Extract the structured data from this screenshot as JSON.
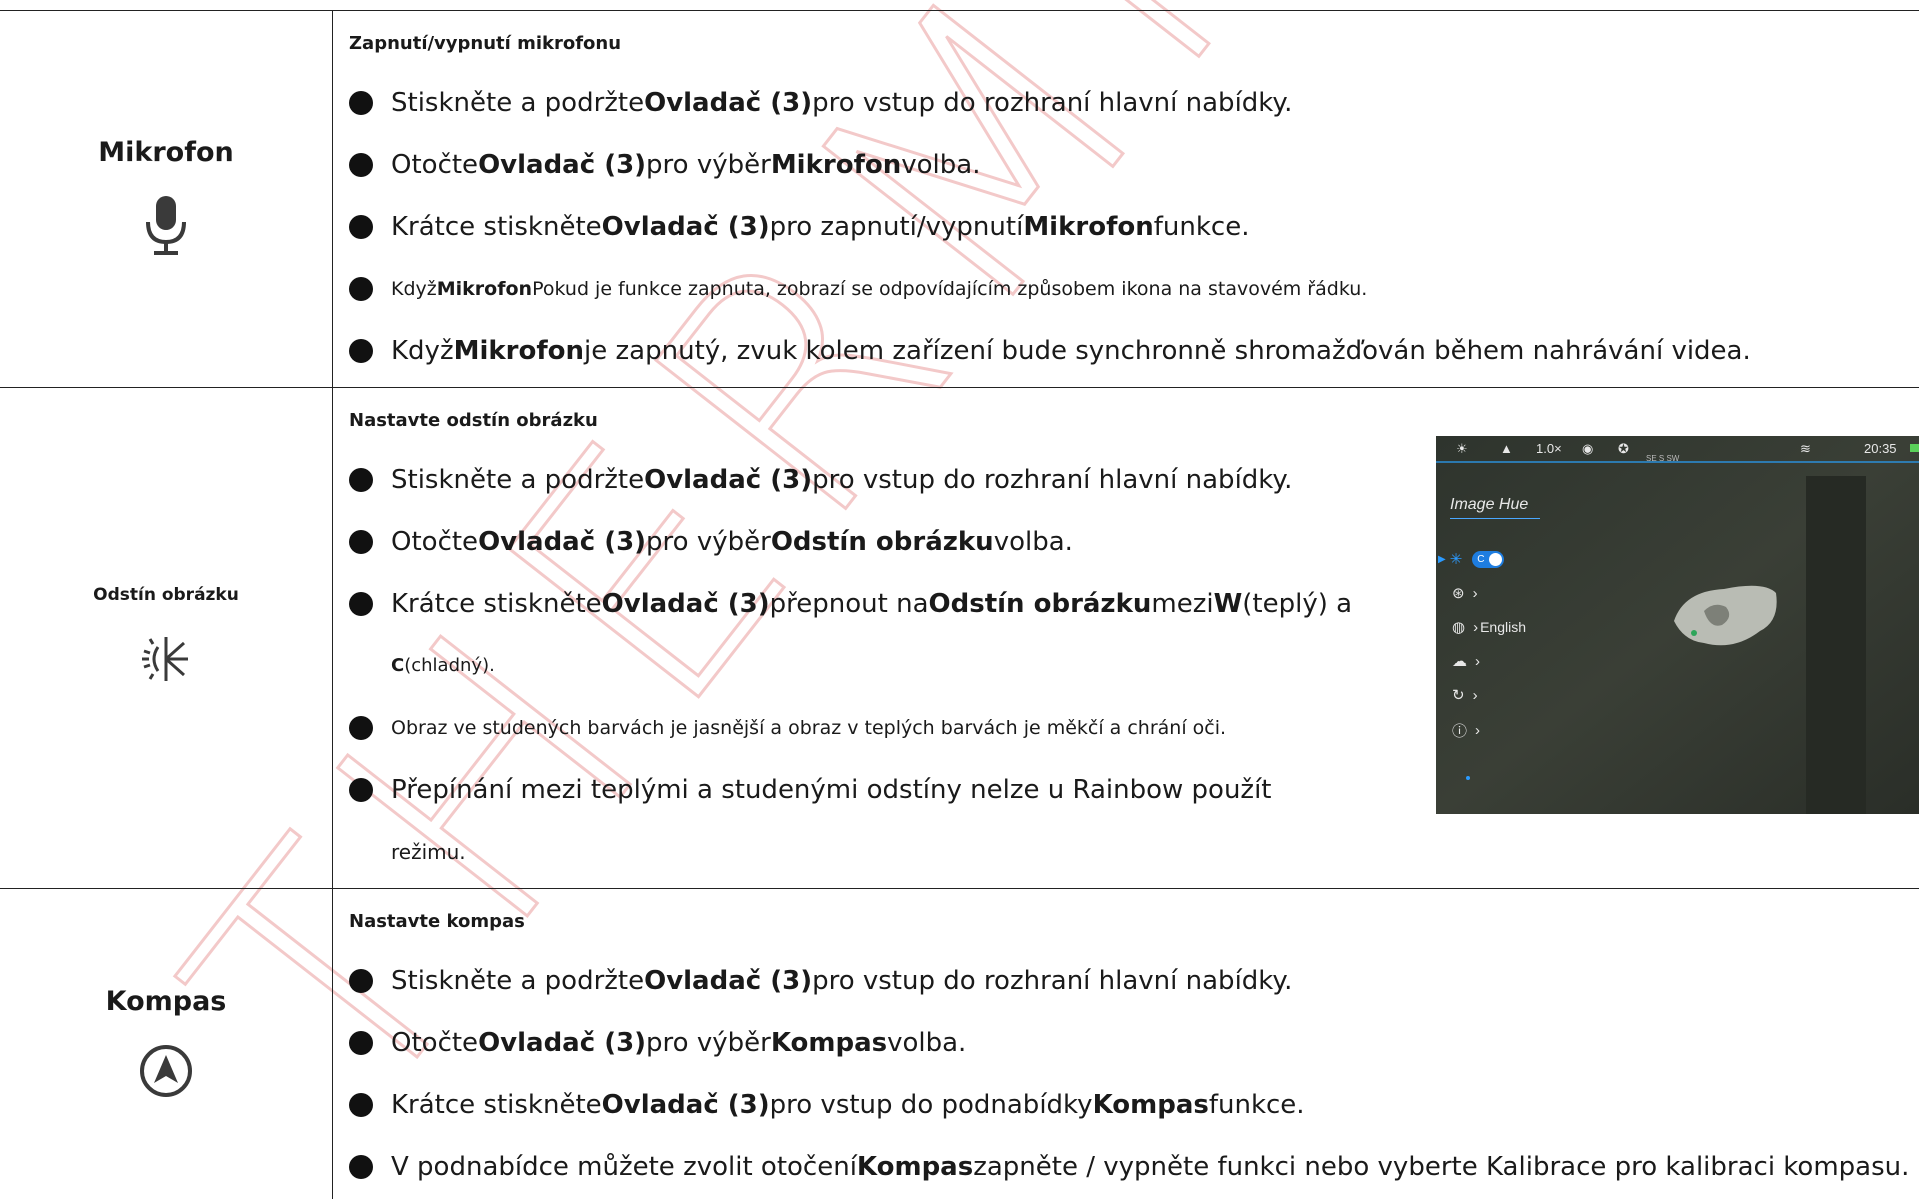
{
  "watermark": "THERMFOX",
  "colors": {
    "accent_blue": "#1e7de0",
    "watermark_red": "#f3c9c9",
    "screen_bg": "#2b2f29"
  },
  "sections": [
    {
      "title": "Mikrofon",
      "icon": "microphone-icon",
      "heading": "Zapnutí/vypnutí mikrofonu",
      "items": [
        {
          "a": "Stiskněte a podržte",
          "b": "Ovladač (3)",
          "c": "pro vstup do rozhraní hlavní nabídky."
        },
        {
          "a": "Otočte",
          "b": "Ovladač (3)",
          "c": "pro výběr",
          "d": "Mikrofon",
          "e": "volba."
        },
        {
          "a": "Krátce stiskněte",
          "b": "Ovladač (3)",
          "c": "pro zapnutí/vypnutí",
          "d": "Mikrofon",
          "e": "funkce."
        },
        {
          "a": "Když",
          "b": "Mikrofon",
          "c": "Pokud je funkce zapnuta, zobrazí se odpovídajícím způsobem ikona na stavovém řádku."
        },
        {
          "a": "Když",
          "b": "Mikrofon",
          "c": "je zapnutý, zvuk kolem zařízení bude synchronně shromažďován během nahrávání videa."
        }
      ]
    },
    {
      "title": "Odstín obrázku",
      "icon": "image-hue-icon",
      "heading": "Nastavte odstín obrázku",
      "items": [
        {
          "a": "Stiskněte a podržte",
          "b": "Ovladač (3)",
          "c": "pro vstup do rozhraní hlavní nabídky."
        },
        {
          "a": "Otočte",
          "b": "Ovladač (3)",
          "c": "pro výběr",
          "d": "Odstín obrázku",
          "e": "volba."
        },
        {
          "a": "Krátce stiskněte",
          "b": "Ovladač (3)",
          "c": "přepnout na",
          "d": "Odstín obrázku",
          "e": "mezi",
          "f": "W",
          "g": "(teplý) a"
        },
        {
          "a": "C",
          "b": "(chladný)."
        },
        {
          "a": "Obraz ve studených barvách je jasnější a obraz v teplých barvách je měkčí a chrání oči."
        },
        {
          "a": "Přepínání mezi teplými a studenými odstíny nelze u Rainbow použít"
        },
        {
          "a": "režimu."
        }
      ],
      "screen": {
        "zoom": "1.0×",
        "time": "20:35",
        "compass": "SE  S  SW",
        "menu_title": "Image Hue",
        "toggle_label": "C",
        "language": "English"
      }
    },
    {
      "title": "Kompas",
      "icon": "compass-icon",
      "heading": "Nastavte kompas",
      "items": [
        {
          "a": "Stiskněte a podržte",
          "b": "Ovladač (3)",
          "c": "pro vstup do rozhraní hlavní nabídky."
        },
        {
          "a": "Otočte",
          "b": "Ovladač (3)",
          "c": "pro výběr",
          "d": "Kompas",
          "e": "volba."
        },
        {
          "a": "Krátce stiskněte",
          "b": "Ovladač (3)",
          "c": "pro vstup do podnabídky",
          "d": "Kompas",
          "e": "funkce."
        },
        {
          "a": "V podnabídce můžete zvolit otočení",
          "b": "Kompas",
          "c": "zapněte / vypněte funkci nebo vyberte Kalibrace pro kalibraci kompasu."
        }
      ]
    }
  ]
}
